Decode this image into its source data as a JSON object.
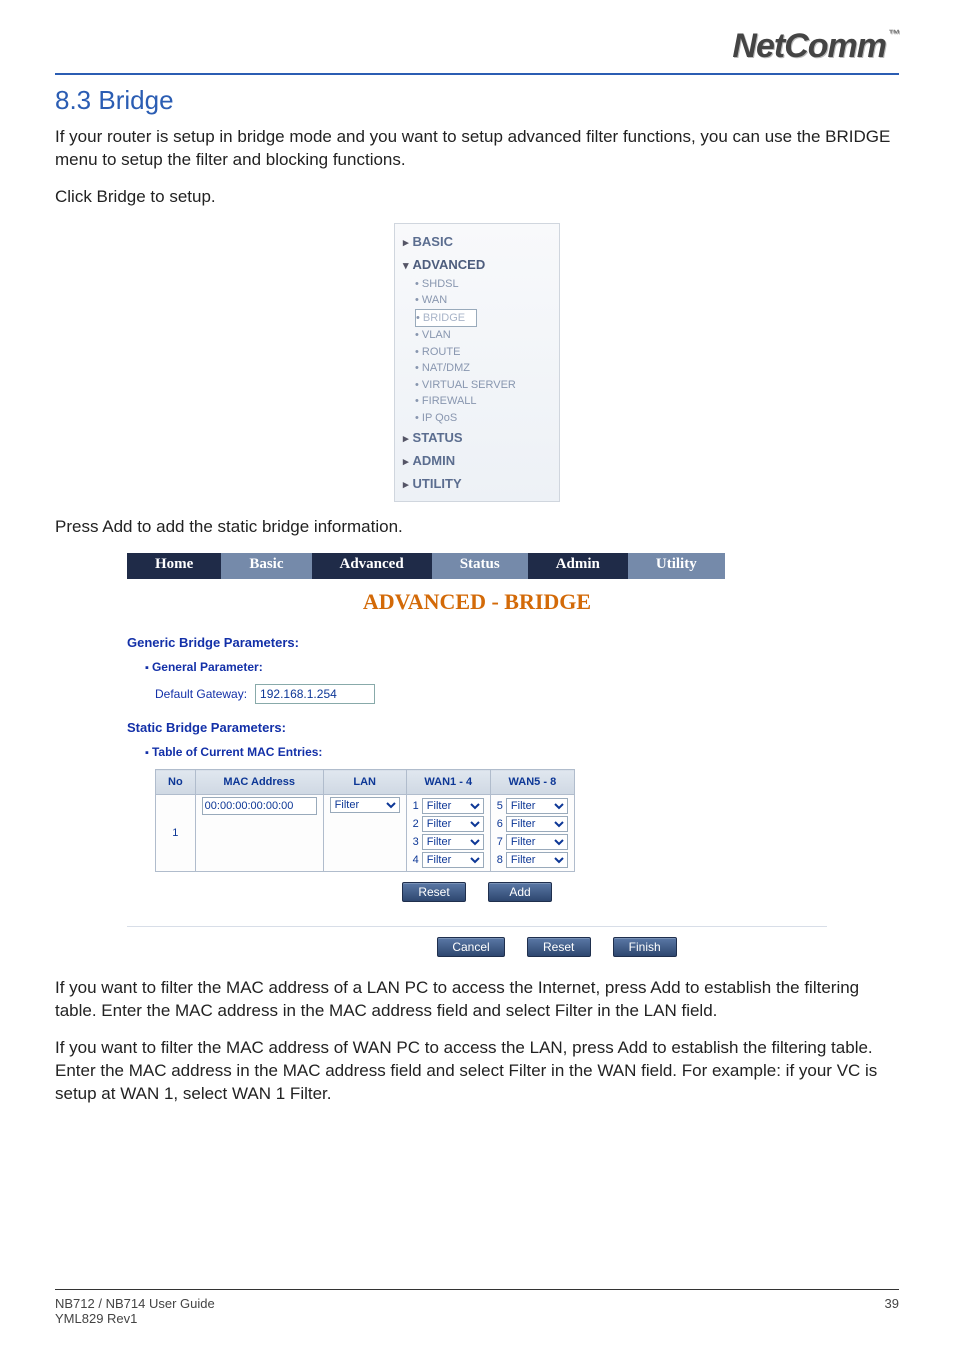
{
  "header": {
    "logo_text": "NetComm",
    "tm": "™"
  },
  "section": {
    "number_title": "8.3 Bridge"
  },
  "paragraphs": {
    "intro": "If your router is setup in bridge mode and you want to setup advanced filter functions, you can use the BRIDGE menu to setup the filter and blocking functions.",
    "click_bridge": "Click Bridge to setup.",
    "press_add": "Press Add to add the static bridge information.",
    "lan_filter": "If you want to filter the  MAC address of a LAN PC to access the Internet, press Add to establish the filtering table. Enter the MAC address in the MAC address field and select Filter in the LAN field.",
    "wan_filter": "If you want to filter the  MAC address of WAN PC to access the LAN, press Add to establish the filtering table. Enter the MAC address in the MAC address field and select Filter in the WAN field. For example: if your VC is setup at WAN 1, select WAN 1 Filter."
  },
  "sidebar": {
    "items": {
      "basic": "BASIC",
      "advanced": "ADVANCED",
      "status": "STATUS",
      "admin": "ADMIN",
      "utility": "UTILITY"
    },
    "advanced_sub": [
      "SHDSL",
      "WAN",
      "BRIDGE",
      "VLAN",
      "ROUTE",
      "NAT/DMZ",
      "VIRTUAL SERVER",
      "FIREWALL",
      "IP QoS"
    ]
  },
  "config": {
    "tabs": [
      "Home",
      "Basic",
      "Advanced",
      "Status",
      "Admin",
      "Utility"
    ],
    "page_title": "ADVANCED - BRIDGE",
    "generic_label": "Generic Bridge Parameters:",
    "general_param_label": "General Parameter:",
    "default_gw_label": "Default Gateway:",
    "default_gw_value": "192.168.1.254",
    "static_label": "Static Bridge Parameters:",
    "table_label": "Table of Current MAC Entries:",
    "table": {
      "headers": {
        "no": "No",
        "mac": "MAC Address",
        "lan": "LAN",
        "wan14": "WAN1 - 4",
        "wan58": "WAN5 - 8"
      },
      "row": {
        "no": "1",
        "mac": "00:00:00:00:00:00",
        "lan_sel": "Filter",
        "wan": [
          {
            "n": "1",
            "v": "Filter"
          },
          {
            "n": "2",
            "v": "Filter"
          },
          {
            "n": "3",
            "v": "Filter"
          },
          {
            "n": "4",
            "v": "Filter"
          },
          {
            "n": "5",
            "v": "Filter"
          },
          {
            "n": "6",
            "v": "Filter"
          },
          {
            "n": "7",
            "v": "Filter"
          },
          {
            "n": "8",
            "v": "Filter"
          }
        ]
      }
    },
    "buttons": {
      "reset_small": "Reset",
      "add": "Add",
      "cancel": "Cancel",
      "reset": "Reset",
      "finish": "Finish"
    }
  },
  "footer": {
    "left1": "NB712 / NB714 User Guide",
    "left2": "YML829 Rev1",
    "right": "39"
  }
}
